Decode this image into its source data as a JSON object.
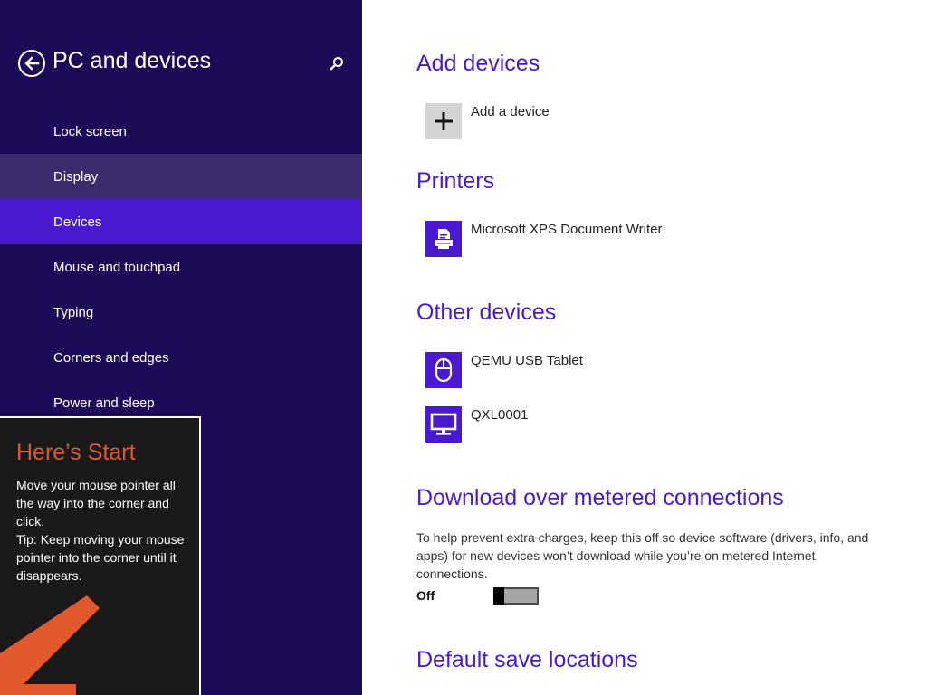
{
  "nav": {
    "title": "PC and devices",
    "back_icon": "back-arrow-icon",
    "search_icon": "search-icon",
    "items": [
      {
        "label": "Lock screen",
        "state": "normal"
      },
      {
        "label": "Display",
        "state": "hover"
      },
      {
        "label": "Devices",
        "state": "selected"
      },
      {
        "label": "Mouse and touchpad",
        "state": "normal"
      },
      {
        "label": "Typing",
        "state": "normal"
      },
      {
        "label": "Corners and edges",
        "state": "normal"
      },
      {
        "label": "Power and sleep",
        "state": "normal"
      }
    ]
  },
  "start_tip": {
    "title": "Here’s Start",
    "line1": "Move your mouse pointer all the way into the corner and click.",
    "line2": "Tip: Keep moving your mouse pointer into the corner until it disappears.",
    "arrow_icon": "corner-arrow-icon"
  },
  "content": {
    "add_devices": {
      "title": "Add devices",
      "add_label": "Add a device",
      "add_icon": "plus-icon"
    },
    "printers": {
      "title": "Printers",
      "items": [
        {
          "label": "Microsoft XPS Document Writer",
          "icon": "printer-icon"
        }
      ]
    },
    "other_devices": {
      "title": "Other devices",
      "items": [
        {
          "label": "QEMU USB Tablet",
          "icon": "mouse-icon"
        },
        {
          "label": "QXL0001",
          "icon": "monitor-icon"
        }
      ]
    },
    "metered": {
      "title": "Download over metered connections",
      "description": "To help prevent extra charges, keep this off so device software (drivers, info, and apps) for new devices won’t download while you’re on metered Internet connections.",
      "toggle_state": "Off",
      "toggle_on": false
    },
    "save_locations": {
      "title": "Default save locations"
    }
  },
  "colors": {
    "nav_background": "#1e0b58",
    "accent": "#4a1ad0",
    "nav_hover": "#3c2c6e",
    "tip_title": "#e2572c",
    "tip_background": "#1a1a1a"
  }
}
